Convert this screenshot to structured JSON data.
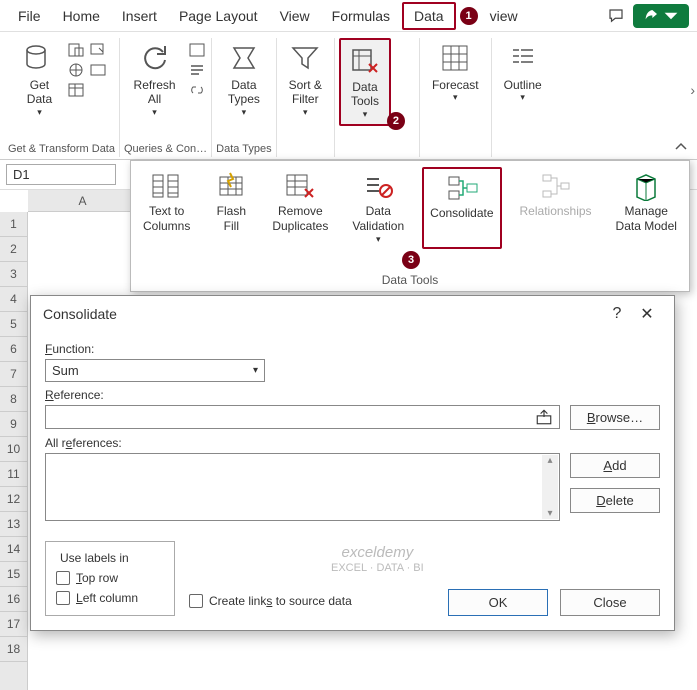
{
  "tabs": {
    "file": "File",
    "home": "Home",
    "insert": "Insert",
    "page_layout": "Page Layout",
    "view": "View",
    "formulas": "Formulas",
    "data": "Data",
    "view2": "view"
  },
  "badges": {
    "b1": "1",
    "b2": "2",
    "b3": "3"
  },
  "ribbon": {
    "get_data": "Get\nData",
    "refresh_all": "Refresh\nAll",
    "data_types": "Data\nTypes",
    "sort_filter": "Sort &\nFilter",
    "data_tools": "Data\nTools",
    "forecast": "Forecast",
    "outline": "Outline",
    "group_get": "Get & Transform Data",
    "group_queries": "Queries & Con…",
    "group_types": "Data Types"
  },
  "namebox": "D1",
  "col_header": "A",
  "rows": [
    "1",
    "2",
    "3",
    "4",
    "5",
    "6",
    "7",
    "8",
    "9",
    "10",
    "11",
    "12",
    "13",
    "14",
    "15",
    "16",
    "17",
    "18"
  ],
  "popup": {
    "text_to_columns": "Text to\nColumns",
    "flash_fill": "Flash\nFill",
    "remove_duplicates": "Remove\nDuplicates",
    "data_validation": "Data\nValidation",
    "consolidate": "Consolidate",
    "relationships": "Relationships",
    "manage_data_model": "Manage\nData Model",
    "title": "Data Tools"
  },
  "dialog": {
    "title": "Consolidate",
    "help": "?",
    "function_label": "Function:",
    "function_value": "Sum",
    "reference_label": "Reference:",
    "browse": "Browse…",
    "all_refs_label": "All references:",
    "add": "Add",
    "delete": "Delete",
    "use_labels": "Use labels in",
    "top_row": "Top row",
    "left_column": "Left column",
    "create_links": "Create links to source data",
    "ok": "OK",
    "close": "Close"
  },
  "watermark": {
    "l1": "exceldemy",
    "l2": "EXCEL · DATA · BI"
  }
}
